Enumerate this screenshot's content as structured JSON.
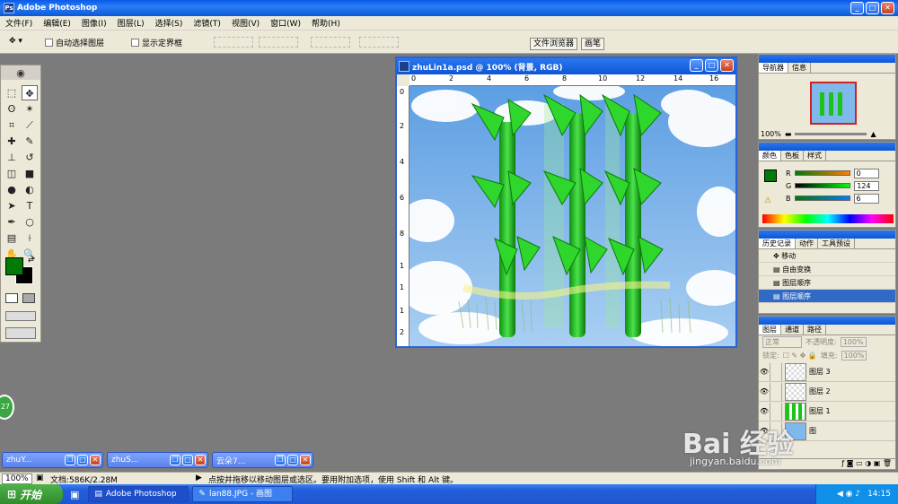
{
  "app": {
    "title": "Adobe Photoshop"
  },
  "menu": [
    "文件(F)",
    "编辑(E)",
    "图像(I)",
    "图层(L)",
    "选择(S)",
    "滤镜(T)",
    "视图(V)",
    "窗口(W)",
    "帮助(H)"
  ],
  "options": {
    "auto_select": "自动选择图层",
    "show_bounds": "显示定界框",
    "file_browser": "文件浏览器",
    "brushes": "画笔"
  },
  "document": {
    "title": "zhuLin1a.psd @ 100% (背景, RGB)",
    "ruler_h": [
      "0",
      "2",
      "4",
      "6",
      "8",
      "10",
      "12",
      "14",
      "16"
    ],
    "ruler_v": [
      "0",
      "2",
      "4",
      "6",
      "8",
      "1",
      "1",
      "1",
      "2"
    ]
  },
  "navigator": {
    "tabs": [
      "导航器",
      "信息"
    ],
    "zoom": "100%"
  },
  "color": {
    "tabs": [
      "颜色",
      "色板",
      "样式"
    ],
    "r": "0",
    "g": "124",
    "b": "6",
    "r_label": "R",
    "g_label": "G",
    "b_label": "B"
  },
  "history": {
    "tabs": [
      "历史记录",
      "动作",
      "工具预设"
    ],
    "items": [
      "移动",
      "自由变换",
      "图层顺序",
      "图层顺序"
    ]
  },
  "layers": {
    "tabs": [
      "图层",
      "通道",
      "路径"
    ],
    "blend": "正常",
    "opacity_label": "不透明度:",
    "opacity": "100%",
    "lock_label": "锁定:",
    "fill_label": "填充:",
    "fill": "100%",
    "items": [
      "图层 3",
      "图层 2",
      "图层 1",
      "图"
    ]
  },
  "minimized": [
    "zhuY...",
    "zhuS...",
    "云朵7..."
  ],
  "status": {
    "zoom": "100%",
    "doc": "文档:586K/2.28M",
    "hint": "点按并拖移以移动图层或选区。要用附加选项，使用 Shift 和 Alt 键。"
  },
  "taskbar": {
    "start": "开始",
    "tasks": [
      "Adobe Photoshop",
      "lan88.JPG - 画图"
    ],
    "time": "14:15"
  },
  "badge": "27",
  "watermark": {
    "logo": "Bai 经验",
    "url": "jingyan.baidu.com"
  },
  "colors": {
    "fg": "#007c06",
    "accent": "#0d55d6"
  }
}
